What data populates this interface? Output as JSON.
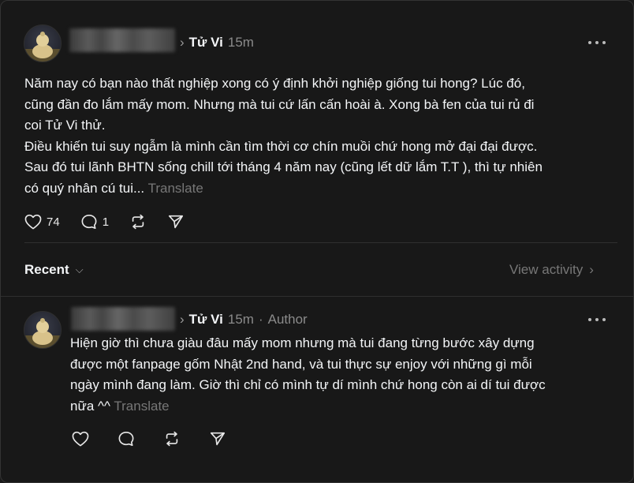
{
  "post": {
    "topic": "Tử Vi",
    "time": "15m",
    "text_lines": [
      "Năm nay có bạn nào thất nghiệp xong có ý định khởi nghiệp giống tui hong? Lúc đó,",
      "cũng đần đo lắm mấy mom. Nhưng mà tui cứ lấn cấn hoài à. Xong bà fen của tui rủ đi",
      "coi Tử Vi thử.",
      "Điều khiến tui suy ngẫm là mình cần tìm thời cơ chín muồi chứ hong mở đại đại được.",
      "Sau đó tui lãnh BHTN sống chill tới tháng 4 năm nay (cũng lết dữ lắm T.T ), thì tự nhiên",
      "có quý nhân cú tui..."
    ],
    "translate": "Translate",
    "likes": "74",
    "replies": "1"
  },
  "filter": {
    "recent_label": "Recent",
    "view_activity": "View activity"
  },
  "reply": {
    "topic": "Tử Vi",
    "time": "15m",
    "author_label": "Author",
    "text_lines": [
      "Hiện giờ thì chưa giàu đâu mấy mom nhưng mà tui đang từng bước xây dựng",
      "được một fanpage gốm Nhật 2nd hand, và tui thực sự enjoy với những gì mỗi",
      "ngày mình đang làm. Giờ thì chỉ có mình tự dí mình chứ hong còn ai dí tui được",
      "nữa ^^"
    ],
    "translate": "Translate"
  },
  "icons": {
    "like": "heart-icon",
    "reply": "comment-icon",
    "repost": "repost-icon",
    "share": "send-icon",
    "more": "more-icon"
  },
  "colors": {
    "background": "#181818",
    "text": "#f3f5f7",
    "muted": "#777777",
    "divider": "#2f2f2f"
  }
}
